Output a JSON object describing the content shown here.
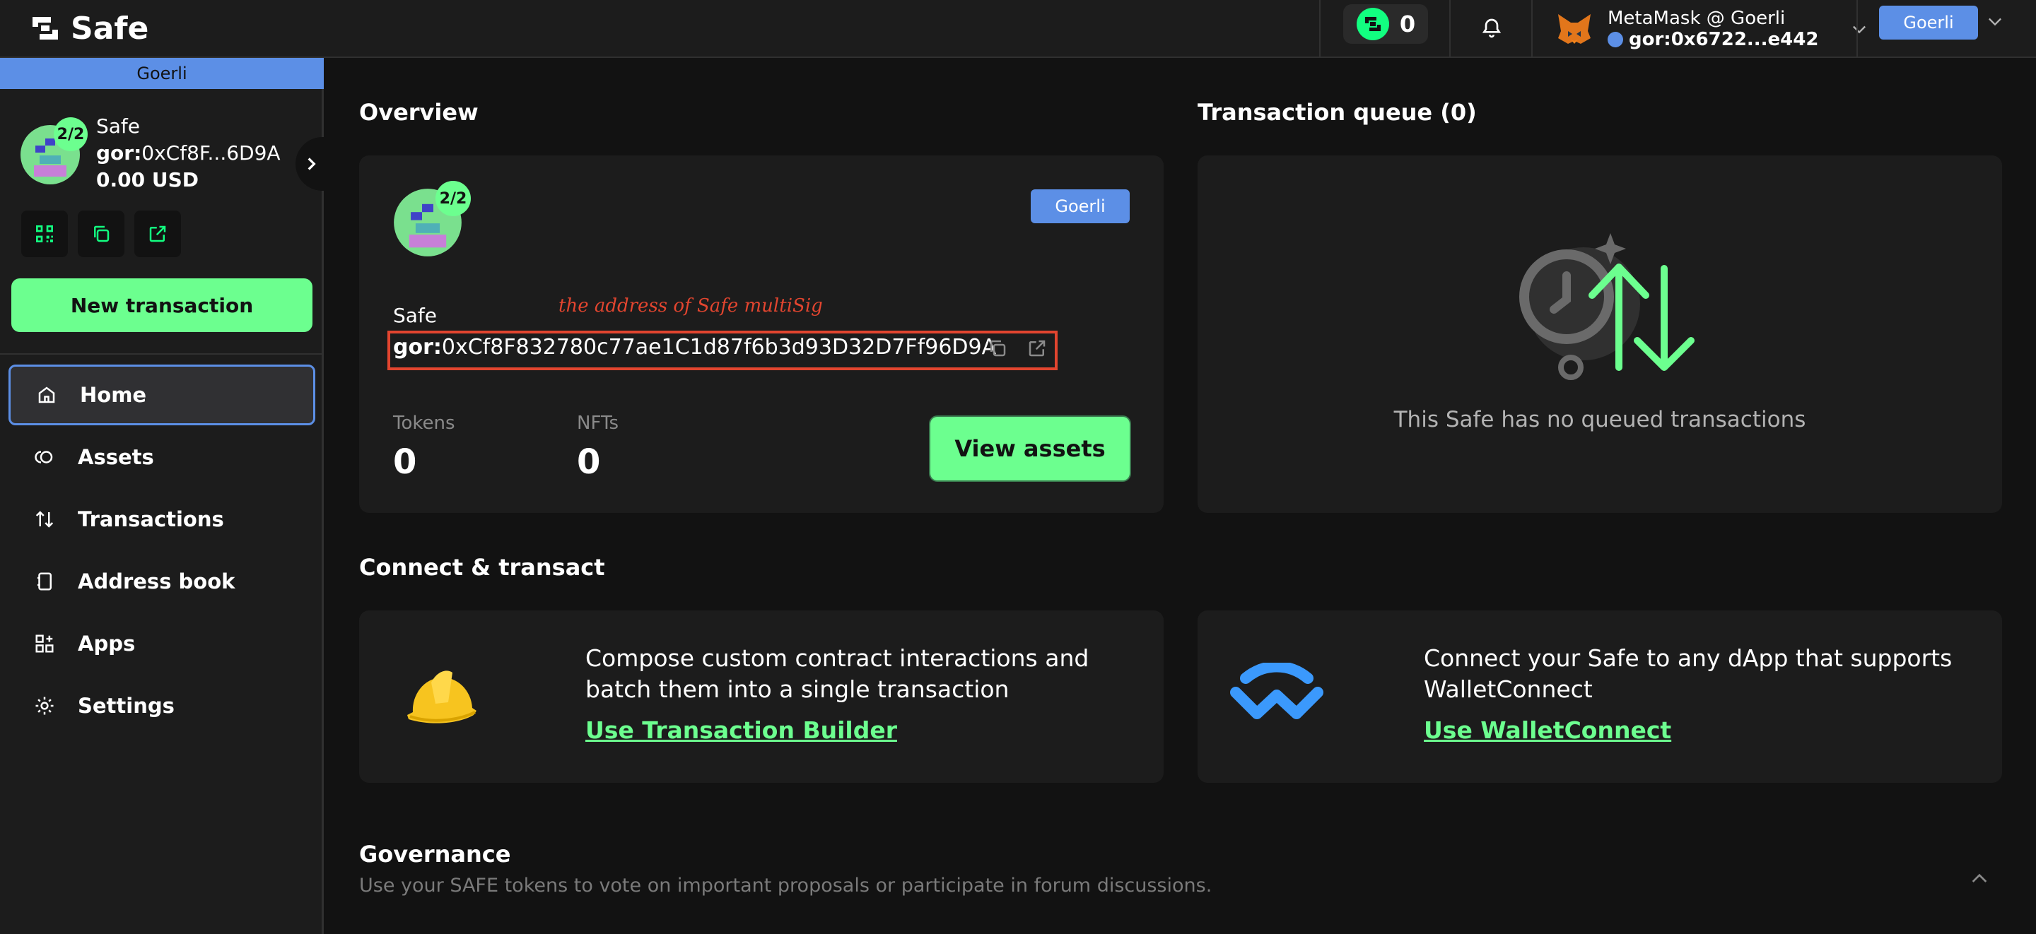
{
  "header": {
    "logo_text": "Safe",
    "counter_value": "0",
    "wallet_name": "MetaMask @ Goerli",
    "wallet_address": "gor:0x6722...e442",
    "network_button": "Goerli"
  },
  "sidebar": {
    "network": "Goerli",
    "threshold": "2/2",
    "safe_name": "Safe",
    "address_prefix": "gor:",
    "address_short": "0xCf8F...6D9A",
    "balance": "0.00 USD",
    "new_transaction": "New transaction",
    "nav": [
      {
        "label": "Home",
        "icon": "home-icon"
      },
      {
        "label": "Assets",
        "icon": "assets-icon"
      },
      {
        "label": "Transactions",
        "icon": "transactions-icon"
      },
      {
        "label": "Address book",
        "icon": "address-book-icon"
      },
      {
        "label": "Apps",
        "icon": "apps-icon"
      },
      {
        "label": "Settings",
        "icon": "settings-icon"
      }
    ]
  },
  "overview": {
    "title": "Overview",
    "threshold": "2/2",
    "network": "Goerli",
    "safe_label": "Safe",
    "annotation": "the address of Safe multiSig",
    "address_prefix": "gor:",
    "address": "0xCf8F832780c77ae1C1d87f6b3d93D32D7Ff96D9A",
    "tokens_label": "Tokens",
    "tokens_value": "0",
    "nfts_label": "NFTs",
    "nfts_value": "0",
    "view_assets": "View assets"
  },
  "queue": {
    "title": "Transaction queue (0)",
    "empty_text": "This Safe has no queued transactions"
  },
  "connect": {
    "title": "Connect & transact",
    "builder_text": "Compose custom contract interactions and batch them into a single transaction",
    "builder_link": "Use Transaction Builder",
    "wc_text": "Connect your Safe to any dApp that supports WalletConnect",
    "wc_link": "Use WalletConnect"
  },
  "governance": {
    "title": "Governance",
    "description": "Use your SAFE tokens to vote on important proposals or participate in forum discussions."
  }
}
